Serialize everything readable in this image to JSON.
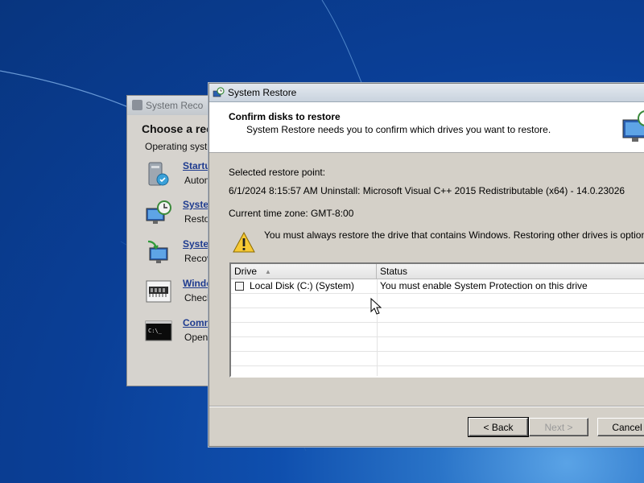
{
  "desktop": {},
  "recovery_window": {
    "title": "System Reco",
    "heading": "Choose a rec",
    "subtitle": "Operating syster",
    "items": [
      {
        "link": "Startu",
        "desc": "Autom",
        "icon": "startup-repair-icon"
      },
      {
        "link": "Syste",
        "desc": "Restor",
        "icon": "system-restore-icon"
      },
      {
        "link": "Syste",
        "desc": "Recov",
        "icon": "system-image-recovery-icon"
      },
      {
        "link": "Windo",
        "desc": "Check",
        "icon": "memory-diagnostic-icon"
      },
      {
        "link": "Comm",
        "desc": "Open a",
        "icon": "command-prompt-icon"
      }
    ]
  },
  "dialog": {
    "title": "System Restore",
    "header_title": "Confirm disks to restore",
    "header_subtitle": "System Restore needs you to confirm which drives you want to restore.",
    "selected_label": "Selected restore point:",
    "restore_point": "6/1/2024 8:15:57 AM Uninstall: Microsoft Visual C++ 2015 Redistributable (x64) - 14.0.23026",
    "timezone": "Current time zone: GMT-8:00",
    "warning": "You must always restore the drive that contains Windows. Restoring other drives is optional.",
    "table": {
      "columns": [
        "Drive",
        "Status"
      ],
      "rows": [
        {
          "drive": "Local Disk (C:) (System)",
          "status": "You must enable System Protection on this drive",
          "checked": false
        }
      ]
    },
    "buttons": {
      "back": "< Back",
      "next": "Next >",
      "cancel": "Cancel"
    }
  },
  "colors": {
    "desktop_blue": "#0f4fae",
    "dialog_face": "#d4d0c8",
    "link_blue": "#1e3b8f"
  }
}
